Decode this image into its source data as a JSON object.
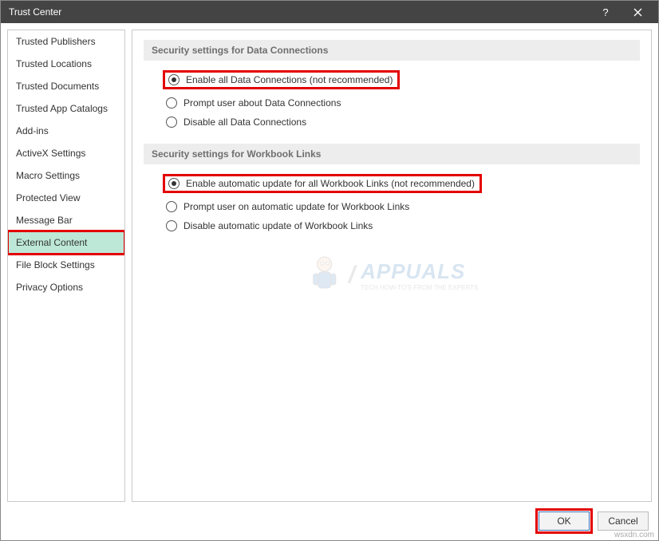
{
  "window": {
    "title": "Trust Center"
  },
  "sidebar": {
    "items": [
      {
        "label": "Trusted Publishers",
        "selected": false
      },
      {
        "label": "Trusted Locations",
        "selected": false
      },
      {
        "label": "Trusted Documents",
        "selected": false
      },
      {
        "label": "Trusted App Catalogs",
        "selected": false
      },
      {
        "label": "Add-ins",
        "selected": false
      },
      {
        "label": "ActiveX Settings",
        "selected": false
      },
      {
        "label": "Macro Settings",
        "selected": false
      },
      {
        "label": "Protected View",
        "selected": false
      },
      {
        "label": "Message Bar",
        "selected": false
      },
      {
        "label": "External Content",
        "selected": true
      },
      {
        "label": "File Block Settings",
        "selected": false
      },
      {
        "label": "Privacy Options",
        "selected": false
      }
    ]
  },
  "sections": {
    "dataConnections": {
      "header": "Security settings for Data Connections",
      "options": {
        "enable": "Enable all Data Connections (not recommended)",
        "prompt": "Prompt user about Data Connections",
        "disable": "Disable all Data Connections"
      },
      "selected": "enable"
    },
    "workbookLinks": {
      "header": "Security settings for Workbook Links",
      "options": {
        "enable": "Enable automatic update for all Workbook Links (not recommended)",
        "prompt": "Prompt user on automatic update for Workbook Links",
        "disable": "Disable automatic update of Workbook Links"
      },
      "selected": "enable"
    }
  },
  "buttons": {
    "ok": "OK",
    "cancel": "Cancel"
  },
  "watermark": "APPUALS",
  "watermark_sub": "TECH HOW-TO'S FROM THE EXPERTS",
  "attribution": "wsxdn.com"
}
